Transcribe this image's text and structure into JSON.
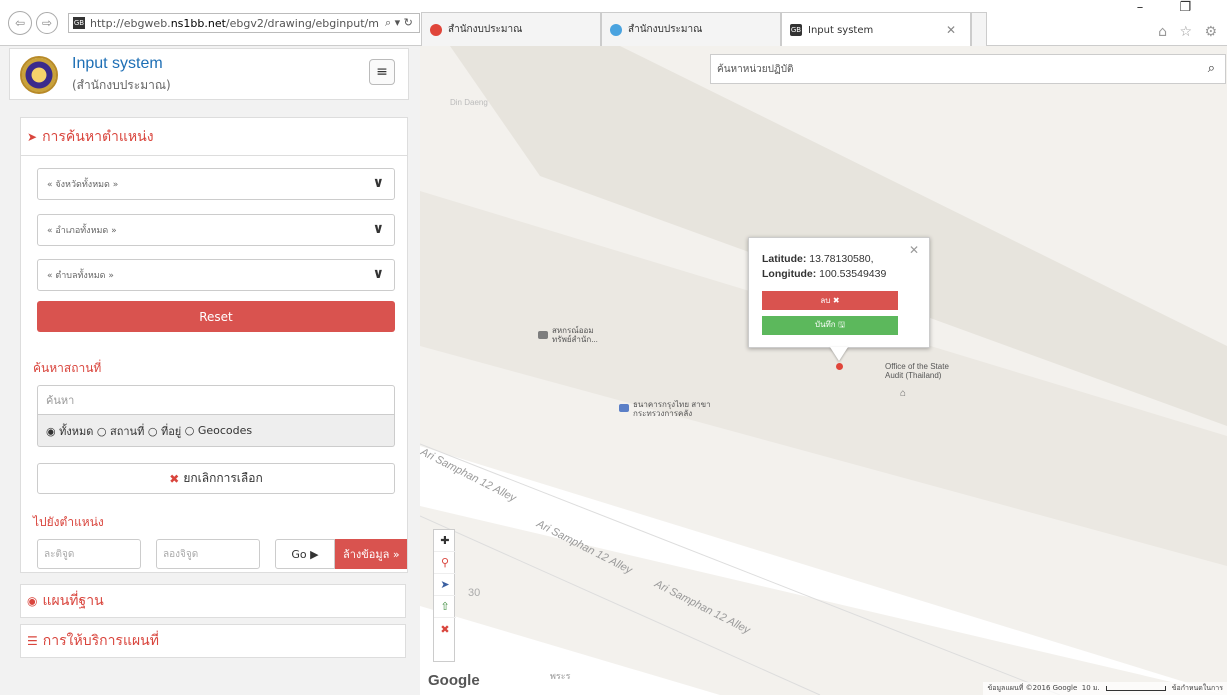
{
  "browser": {
    "url_prefix": "http://ebgweb.",
    "url_domain": "ns1bb.net",
    "url_path": "/ebgv2/drawing/ebginput/m",
    "url_controls": "⌕ ▾ ↻",
    "window_controls": "– ❐",
    "right_icons": "⌂ ☆ ⚙",
    "tabs": [
      {
        "label": "สำนักงบประมาณ",
        "icon_color": "#e0453a",
        "active": false
      },
      {
        "label": "สำนักงบประมาณ",
        "icon_color": "#4aa3df",
        "active": false
      },
      {
        "label": "Input system",
        "icon_color": "#333333",
        "active": true
      }
    ],
    "tab_close": "✕"
  },
  "app": {
    "title": "Input system",
    "subtitle": "(สำนักงบประมาณ)",
    "menu_icon": "≡"
  },
  "location_panel": {
    "title": "การค้นหาตำแหน่ง",
    "title_icon": "➤",
    "province_select": "« จังหวัดทั้งหมด »",
    "district_select": "« อำเภอทั้งหมด »",
    "subdistrict_select": "« ตำบลทั้งหมด »",
    "chevron": "∨",
    "reset_label": "Reset",
    "place_search_label": "ค้นหาสถานที่",
    "search_placeholder": "ค้นหา",
    "radio_all": "ทั้งหมด",
    "radio_place": "สถานที่",
    "radio_address": "ที่อยู่",
    "radio_geocodes": "Geocodes",
    "radio_selected": "◉",
    "radio_empty": "○",
    "cancel_selection_label": "ยกเลิกการเลือก",
    "cancel_icon": "✖",
    "goto_label": "ไปยังตำแหน่ง",
    "latitude_placeholder": "ละติจูด",
    "longitude_placeholder": "ลองจิจูด",
    "go_label": "Go ▶",
    "clear_data_label": "ล้างข้อมูล »"
  },
  "accordion": {
    "basemap_label": "แผนที่ฐาน",
    "basemap_icon": "◉",
    "services_label": "การให้บริการแผนที่",
    "services_icon": "☰"
  },
  "map": {
    "search_placeholder": "ค้นหาหน่วยปฏิบัติ",
    "search_icon": "⌕",
    "popup": {
      "lat_label": "Latitude:",
      "lat_value": "13.78130580,",
      "lng_label": "Longitude:",
      "lng_value": "100.53549439",
      "close": "✕",
      "delete_label": "ลบ ✖",
      "save_label": "บันทึก 🖫"
    },
    "pois": {
      "coop_line1": "สหกรณ์ออม",
      "coop_line2": "ทรัพย์สำนัก...",
      "bank_line1": "ธนาคารกรุงไทย สาขา",
      "bank_line2": "กระทรวงการคลัง",
      "osa_line1": "Office of the State",
      "osa_line2": "Audit (Thailand)",
      "osa_icon": "⌂",
      "faded_label": "Din Daeng",
      "number_label": "30",
      "partial_road": "พระร"
    },
    "roads": [
      "Ari Samphan 12 Alley",
      "Ari Samphan 12 Alley",
      "Ari Samphan 12 Alley"
    ],
    "tools": [
      "✚",
      "⚲",
      "➤",
      "⇧",
      "✖"
    ],
    "google_label": "Google",
    "attribution": "ข้อมูลแผนที่ ©2016 Google",
    "scale_label": "10 ม.",
    "terms": "ข้อกำหนดในการ"
  }
}
